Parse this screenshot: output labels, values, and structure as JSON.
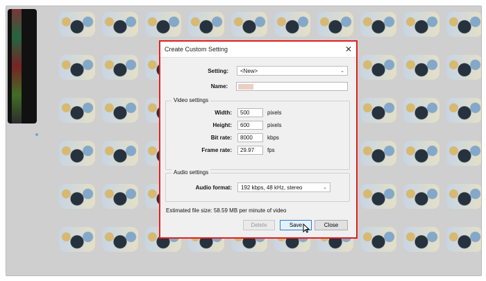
{
  "dialog": {
    "title": "Create Custom Setting",
    "setting_label": "Setting:",
    "setting_value": "<New>",
    "name_label": "Name:",
    "name_value": "",
    "video_group_title": "Video settings",
    "width_label": "Width:",
    "width_value": "500",
    "width_unit": "pixels",
    "height_label": "Height:",
    "height_value": "600",
    "height_unit": "pixels",
    "bitrate_label": "Bit rate:",
    "bitrate_value": "8000",
    "bitrate_unit": "kbps",
    "framerate_label": "Frame rate:",
    "framerate_value": "29.97",
    "framerate_unit": "fps",
    "audio_group_title": "Audio settings",
    "audio_format_label": "Audio format:",
    "audio_format_value": "192 kbps, 48 kHz, stereo",
    "estimate_text": "Estimated file size: 58.59 MB per minute of video",
    "buttons": {
      "delete": "Delete",
      "save": "Save",
      "close": "Close"
    }
  },
  "colors": {
    "highlight_border": "#e02020",
    "primary_button_border": "#2a7fd4"
  },
  "icons": {
    "close": "close-icon",
    "dropdown": "chevron-down-icon",
    "cursor": "mouse-cursor-icon"
  }
}
